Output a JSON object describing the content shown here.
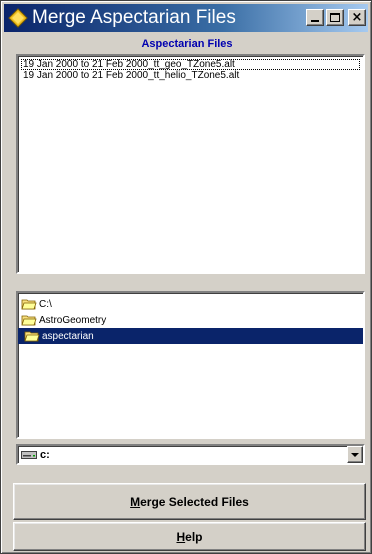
{
  "window": {
    "title": "Merge Aspectarian Files",
    "controls": {
      "minimize": "minimize-icon",
      "maximize": "maximize-icon",
      "close": "close-icon"
    }
  },
  "files_section": {
    "label": "Aspectarian Files",
    "items": [
      "19 Jan 2000 to 21 Feb 2000_tt_geo_TZone5.alt",
      "19 Jan 2000 to 21 Feb 2000_tt_helio_TZone5.alt"
    ]
  },
  "directories": {
    "items": [
      {
        "label": "C:\\",
        "icon": "open-folder-icon",
        "selected": false
      },
      {
        "label": "AstroGeometry",
        "icon": "open-folder-icon",
        "selected": false
      },
      {
        "label": "aspectarian",
        "icon": "open-folder-icon",
        "selected": true
      }
    ]
  },
  "drive": {
    "value": "c:",
    "icon": "drive-icon"
  },
  "buttons": {
    "merge": {
      "mnemonic": "M",
      "rest": "erge Selected Files"
    },
    "help": {
      "mnemonic": "H",
      "rest": "elp"
    }
  },
  "colors": {
    "title_bar_start": "#0a246a",
    "title_bar_end": "#a6caf0",
    "section_label": "#0000b0",
    "selection": "#0a246a",
    "face": "#d4d0c8"
  }
}
